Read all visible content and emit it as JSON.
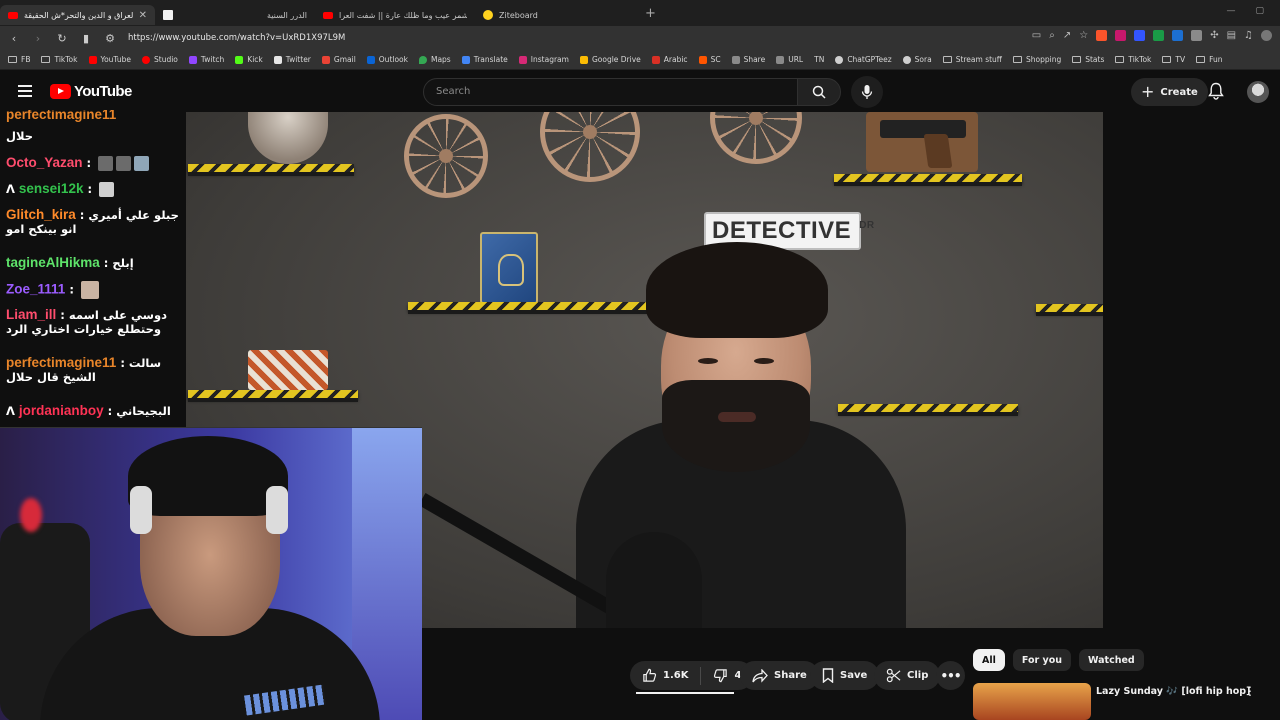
{
  "browser": {
    "tabs": [
      {
        "label": "العراق و الدين والتحر*ش الحقيقة !!",
        "active": true
      },
      {
        "label": "",
        "active": false
      },
      {
        "label": "الدرر السنية",
        "active": false
      },
      {
        "label": "يا شمر عيب وما ظلك عارة || شفت العرا",
        "active": false
      },
      {
        "label": "Ziteboard",
        "active": false
      }
    ],
    "url": "https://www.youtube.com/watch?v=UxRD1X97L9M",
    "bookmarks": [
      "FB",
      "TikTok",
      "YouTube",
      "Studio",
      "Twitch",
      "Kick",
      "Twitter",
      "Gmail",
      "Outlook",
      "Maps",
      "Translate",
      "Instagram",
      "Google Drive",
      "Arabic",
      "SC",
      "Share",
      "URL",
      "TN",
      "ChatGPTeez",
      "Sora",
      "Stream stuff",
      "Shopping",
      "Stats",
      "TikTok",
      "TV",
      "Fun"
    ]
  },
  "youtube": {
    "logo_text": "YouTube",
    "search_placeholder": "Search",
    "create_label": "Create"
  },
  "chat": {
    "messages": [
      {
        "user": "perfectimagine11",
        "user_color": "#e8852a",
        "text": "حلال"
      },
      {
        "user": "Octo_Yazan",
        "user_color": "#ff4d6d",
        "text": ""
      },
      {
        "user": "sensei12k",
        "user_color": "#33c24d",
        "text": ""
      },
      {
        "user": "Glitch_kira",
        "user_color": "#ff8a2a",
        "text": "جبلو علي أميري انو بينكح امو"
      },
      {
        "user": "tagineAlHikma",
        "user_color": "#5ee36a",
        "text": "إبلح"
      },
      {
        "user": "Zoe_1111",
        "user_color": "#9b5cff",
        "text": ""
      },
      {
        "user": "Liam_ill",
        "user_color": "#ff4d6d",
        "text": "دوسي على اسمه وحتطلع خيارات اختاري الرد"
      },
      {
        "user": "perfectimagine11",
        "user_color": "#e8852a",
        "text": "سالت الشيخ قال حلال"
      },
      {
        "user": "jordanianboy",
        "user_color": "#ff3355",
        "text": "البجيحاني"
      }
    ]
  },
  "video": {
    "sign_text": "DETECTIVE",
    "sign_small": "DR"
  },
  "actions": {
    "like_count": "1.6K",
    "dislike_count": "4",
    "share_label": "Share",
    "save_label": "Save",
    "clip_label": "Clip"
  },
  "sidebar": {
    "chips": [
      "All",
      "For you",
      "Watched"
    ],
    "selected_chip": "All",
    "rec_title": "Lazy Sunday 🎶 [lofi hip hop]"
  },
  "colors": {
    "yt_red": "#ff0000",
    "background": "#0f0f0f",
    "chip_bg": "#272727"
  }
}
